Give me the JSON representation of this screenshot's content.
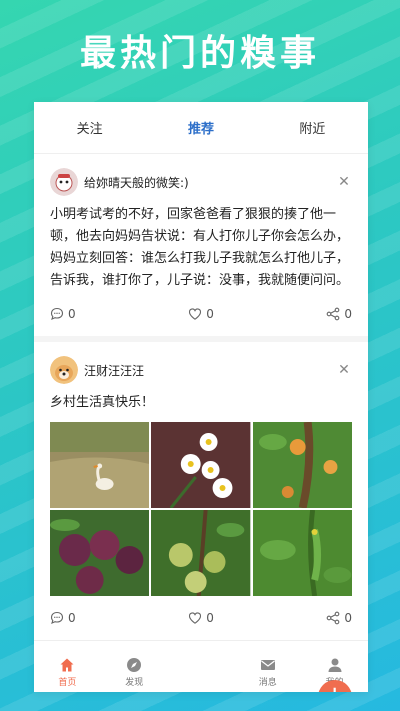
{
  "hero": {
    "title": "最热门的糗事"
  },
  "tabs": [
    {
      "label": "关注"
    },
    {
      "label": "推荐",
      "active": true
    },
    {
      "label": "附近"
    }
  ],
  "posts": [
    {
      "username": "给妳晴天般的微笑:)",
      "text": "小明考试考的不好，回家爸爸看了狠狠的揍了他一顿，他去向妈妈告状说：有人打你儿子你会怎么办，妈妈立刻回答：谁怎么打我儿子我就怎么打他儿子，告诉我，谁打你了，儿子说：没事，我就随便问问。",
      "comments": "0",
      "likes": "0",
      "shares": "0"
    },
    {
      "username": "汪财汪汪汪",
      "text": "乡村生活真快乐！",
      "comments": "0",
      "likes": "0",
      "shares": "0"
    }
  ],
  "nav": [
    {
      "label": "首页",
      "icon": "home-icon",
      "active": true
    },
    {
      "label": "发现",
      "icon": "compass-icon"
    },
    {
      "label": "",
      "icon": "plus-icon"
    },
    {
      "label": "消息",
      "icon": "mail-icon"
    },
    {
      "label": "我的",
      "icon": "user-icon"
    }
  ],
  "colors": {
    "accent": "#2d6fc9",
    "nav_active": "#f06d4f",
    "fab": "#f06d4f"
  }
}
